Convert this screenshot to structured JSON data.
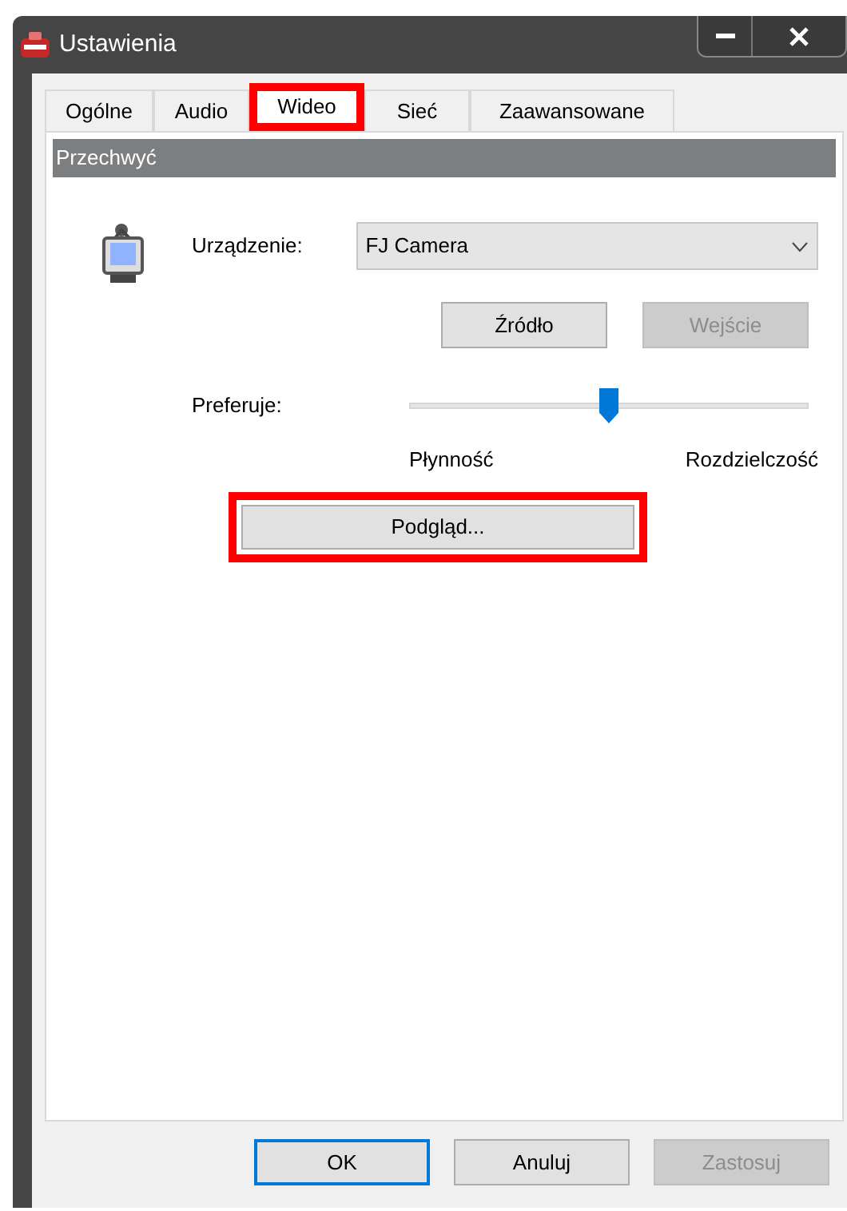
{
  "window": {
    "title": "Ustawienia"
  },
  "tabs": [
    {
      "label": "Ogólne",
      "selected": false,
      "highlighted": false
    },
    {
      "label": "Audio",
      "selected": false,
      "highlighted": false
    },
    {
      "label": "Wideo",
      "selected": true,
      "highlighted": true
    },
    {
      "label": "Sieć",
      "selected": false,
      "highlighted": false
    },
    {
      "label": "Zaawansowane",
      "selected": false,
      "highlighted": false
    }
  ],
  "group": {
    "title": "Przechwyć"
  },
  "device": {
    "label": "Urządzenie:",
    "value": "FJ Camera"
  },
  "device_buttons": [
    {
      "label": "Źródło",
      "disabled": false
    },
    {
      "label": "Wejście",
      "disabled": true
    }
  ],
  "preference": {
    "label": "Preferuje:",
    "level": 0.5,
    "min_label": "Płynność",
    "max_label": "Rozdzielczość"
  },
  "preview_button": {
    "label": "Podgląd...",
    "highlighted": true
  },
  "buttons": [
    {
      "label": "OK",
      "default": true,
      "disabled": false
    },
    {
      "label": "Anuluj",
      "default": false,
      "disabled": false
    },
    {
      "label": "Zastosuj",
      "default": false,
      "disabled": true
    }
  ]
}
